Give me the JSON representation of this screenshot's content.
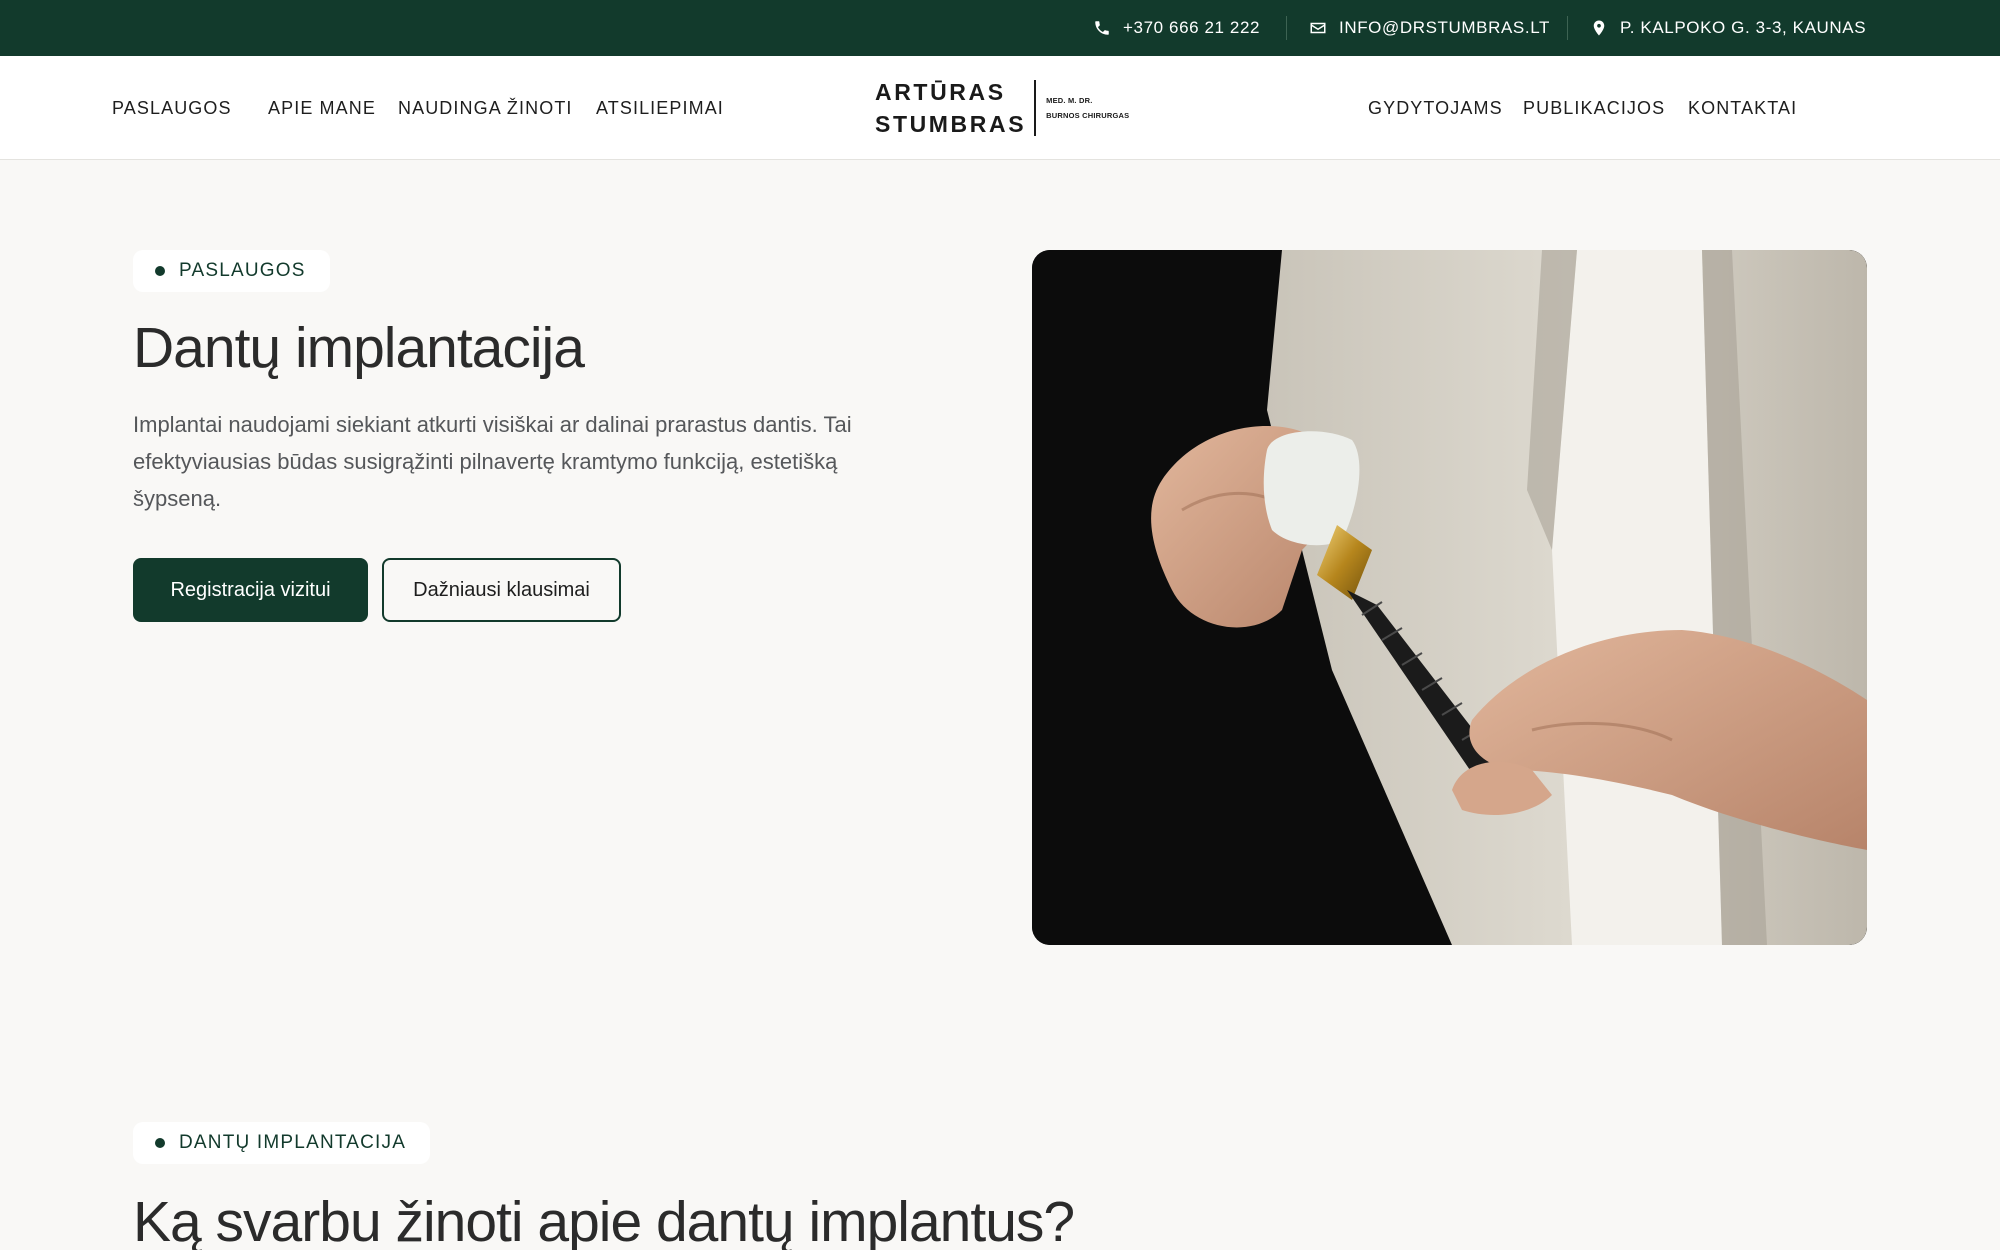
{
  "topbar": {
    "phone": "+370 666 21 222",
    "email": "INFO@DRSTUMBRAS.LT",
    "address": "P. KALPOKO G. 3-3, KAUNAS",
    "icons": [
      "phone-icon",
      "mail-icon",
      "location-pin-icon"
    ]
  },
  "nav": {
    "left": [
      "PASLAUGOS",
      "APIE MANE",
      "NAUDINGA ŽINOTI",
      "ATSILIEPIMAI"
    ],
    "right": [
      "GYDYTOJAMS",
      "PUBLIKACIJOS",
      "KONTAKTAI"
    ]
  },
  "logo": {
    "name_line1": "ARTŪRAS",
    "name_line2": "STUMBRAS",
    "sub_line1": "MED. M. DR.",
    "sub_line2": "BURNOS CHIRURGAS"
  },
  "hero": {
    "badge": "PASLAUGOS",
    "title": "Dantų implantacija",
    "description": "Implantai naudojami siekiant atkurti visiškai ar dalinai prarastus dantis. Tai efektyviausias būdas susigrąžinti pilnavertę kramtymo funkciją, estetišką šypseną.",
    "primary_button": "Registracija vizitui",
    "secondary_button": "Dažniausi klausimai"
  },
  "section2": {
    "badge": "DANTŲ IMPLANTACIJA",
    "title": "Ką svarbu žinoti apie dantų implantus?"
  },
  "colors": {
    "brand_dark_green": "#123a2c",
    "page_background": "#f9f8f6",
    "white": "#ffffff"
  }
}
